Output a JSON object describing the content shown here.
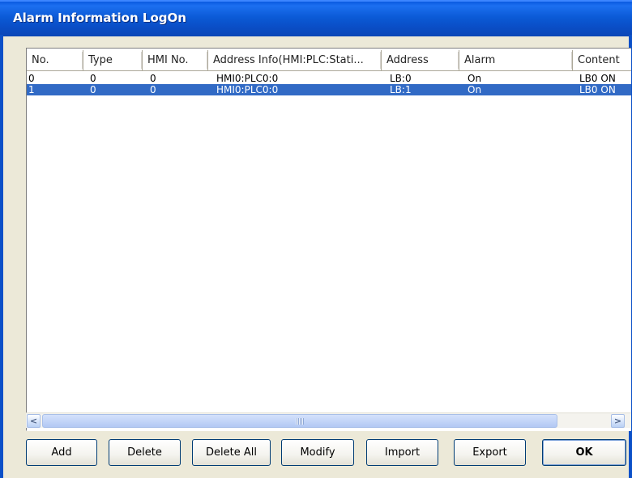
{
  "window": {
    "title": "Alarm Information LogOn"
  },
  "table": {
    "columns": [
      "No.",
      "Type",
      "HMI No.",
      "Address Info(HMI:PLC:Stati...",
      "Address",
      "Alarm",
      "Content"
    ],
    "rows": [
      [
        "0",
        "0",
        "0",
        "HMI0:PLC0:0",
        "LB:0",
        "On",
        "LB0 ON"
      ],
      [
        "1",
        "0",
        "0",
        "HMI0:PLC0:0",
        "LB:1",
        "On",
        "LB0 ON"
      ]
    ],
    "selected_row": 1
  },
  "scrollbar": {
    "left_arrow": "<",
    "right_arrow": ">"
  },
  "buttons": {
    "add": "Add",
    "delete": "Delete",
    "delete_all": "Delete All",
    "modify": "Modify",
    "import": "Import",
    "export": "Export",
    "ok": "OK"
  },
  "colors": {
    "titlebar": "#0b5ad6",
    "selection": "#316ac5",
    "dialog_bg": "#ece9d8"
  }
}
